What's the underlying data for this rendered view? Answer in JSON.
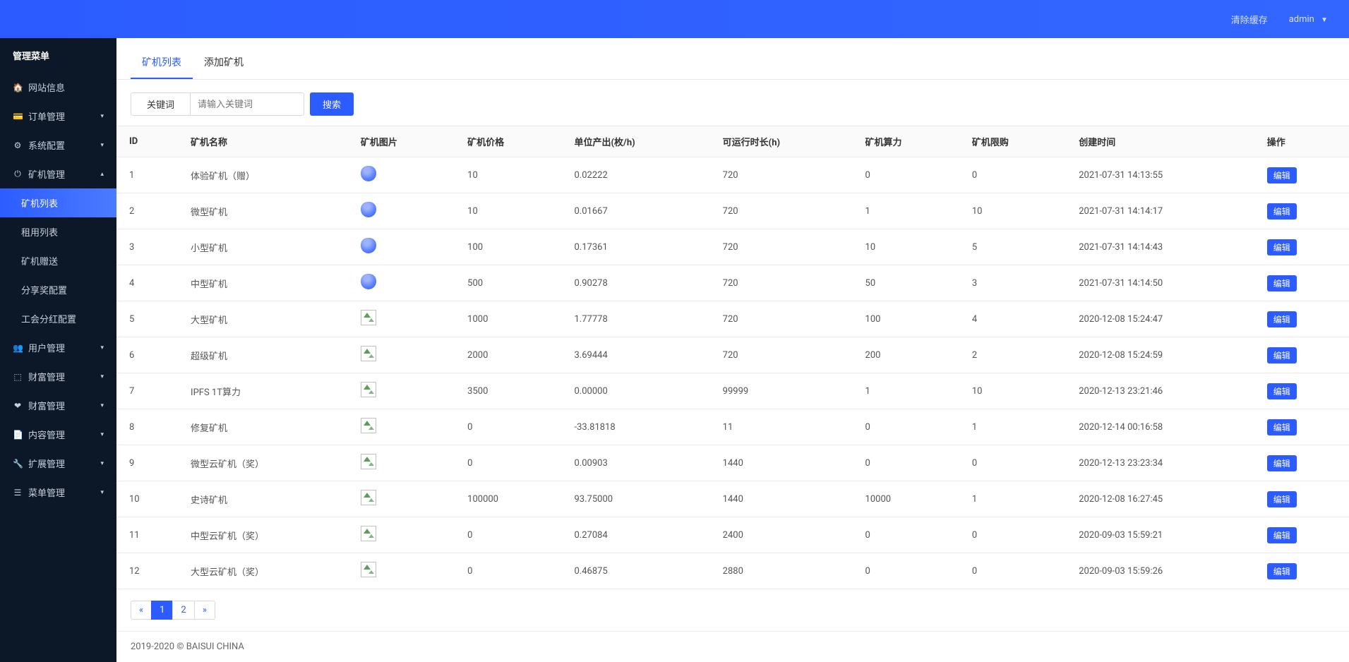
{
  "header": {
    "clear_cache": "清除缓存",
    "user": "admin"
  },
  "sidebar": {
    "title": "管理菜单",
    "items": [
      {
        "icon": "🏠",
        "label": "网站信息",
        "arrow": ""
      },
      {
        "icon": "💳",
        "label": "订单管理",
        "arrow": "▾"
      },
      {
        "icon": "⚙",
        "label": "系统配置",
        "arrow": "▾"
      },
      {
        "icon": "⏻",
        "label": "矿机管理",
        "arrow": "▴"
      },
      {
        "icon": "👥",
        "label": "用户管理",
        "arrow": "▾"
      },
      {
        "icon": "⬚",
        "label": "财富管理",
        "arrow": "▾"
      },
      {
        "icon": "❤",
        "label": "财富管理",
        "arrow": "▾"
      },
      {
        "icon": "📄",
        "label": "内容管理",
        "arrow": "▾"
      },
      {
        "icon": "🔧",
        "label": "扩展管理",
        "arrow": "▾"
      },
      {
        "icon": "☰",
        "label": "菜单管理",
        "arrow": "▾"
      }
    ],
    "sub_items": [
      {
        "label": "矿机列表",
        "active": true
      },
      {
        "label": "租用列表",
        "active": false
      },
      {
        "label": "矿机赠送",
        "active": false
      },
      {
        "label": "分享奖配置",
        "active": false
      },
      {
        "label": "工会分红配置",
        "active": false
      }
    ]
  },
  "tabs": [
    {
      "label": "矿机列表",
      "active": true
    },
    {
      "label": "添加矿机",
      "active": false
    }
  ],
  "search": {
    "addon": "关键词",
    "placeholder": "请输入关键词",
    "button": "搜索"
  },
  "table": {
    "headers": [
      "ID",
      "矿机名称",
      "矿机图片",
      "矿机价格",
      "单位产出(枚/h)",
      "可运行时长(h)",
      "矿机算力",
      "矿机限购",
      "创建时间",
      "操作"
    ],
    "edit_label": "编辑",
    "rows": [
      {
        "id": "1",
        "name": "体验矿机（赠）",
        "img": "filled",
        "price": "10",
        "output": "0.02222",
        "runtime": "720",
        "power": "0",
        "limit": "0",
        "created": "2021-07-31 14:13:55"
      },
      {
        "id": "2",
        "name": "微型矿机",
        "img": "filled",
        "price": "10",
        "output": "0.01667",
        "runtime": "720",
        "power": "1",
        "limit": "10",
        "created": "2021-07-31 14:14:17"
      },
      {
        "id": "3",
        "name": "小型矿机",
        "img": "filled",
        "price": "100",
        "output": "0.17361",
        "runtime": "720",
        "power": "10",
        "limit": "5",
        "created": "2021-07-31 14:14:43"
      },
      {
        "id": "4",
        "name": "中型矿机",
        "img": "filled",
        "price": "500",
        "output": "0.90278",
        "runtime": "720",
        "power": "50",
        "limit": "3",
        "created": "2021-07-31 14:14:50"
      },
      {
        "id": "5",
        "name": "大型矿机",
        "img": "broken",
        "price": "1000",
        "output": "1.77778",
        "runtime": "720",
        "power": "100",
        "limit": "4",
        "created": "2020-12-08 15:24:47"
      },
      {
        "id": "6",
        "name": "超级矿机",
        "img": "broken",
        "price": "2000",
        "output": "3.69444",
        "runtime": "720",
        "power": "200",
        "limit": "2",
        "created": "2020-12-08 15:24:59"
      },
      {
        "id": "7",
        "name": "IPFS 1T算力",
        "img": "broken",
        "price": "3500",
        "output": "0.00000",
        "runtime": "99999",
        "power": "1",
        "limit": "10",
        "created": "2020-12-13 23:21:46"
      },
      {
        "id": "8",
        "name": "修复矿机",
        "img": "broken",
        "price": "0",
        "output": "-33.81818",
        "runtime": "11",
        "power": "0",
        "limit": "1",
        "created": "2020-12-14 00:16:58"
      },
      {
        "id": "9",
        "name": "微型云矿机（奖）",
        "img": "broken",
        "price": "0",
        "output": "0.00903",
        "runtime": "1440",
        "power": "0",
        "limit": "0",
        "created": "2020-12-13 23:23:34"
      },
      {
        "id": "10",
        "name": "史诗矿机",
        "img": "broken",
        "price": "100000",
        "output": "93.75000",
        "runtime": "1440",
        "power": "10000",
        "limit": "1",
        "created": "2020-12-08 16:27:45"
      },
      {
        "id": "11",
        "name": "中型云矿机（奖）",
        "img": "broken",
        "price": "0",
        "output": "0.27084",
        "runtime": "2400",
        "power": "0",
        "limit": "0",
        "created": "2020-09-03 15:59:21"
      },
      {
        "id": "12",
        "name": "大型云矿机（奖）",
        "img": "broken",
        "price": "0",
        "output": "0.46875",
        "runtime": "2880",
        "power": "0",
        "limit": "0",
        "created": "2020-09-03 15:59:26"
      }
    ]
  },
  "pagination": {
    "prev": "«",
    "next": "»",
    "pages": [
      "1",
      "2"
    ],
    "active": "1"
  },
  "footer": "2019-2020 © BAISUI CHINA"
}
